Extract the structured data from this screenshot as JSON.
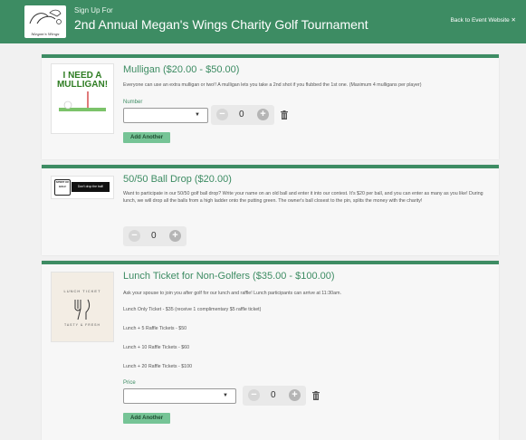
{
  "header": {
    "logo_text": "Megan's Wings",
    "subtitle": "Sign Up For",
    "title": "2nd Annual Megan's Wings Charity Golf Tournament",
    "back_link": "Back to Event Website ✕"
  },
  "items": [
    {
      "thumb_text": [
        "I NEED A",
        "MULLIGAN!"
      ],
      "title": "Mulligan ($20.00 - $50.00)",
      "description": "Everyone can use an extra mulligan or two!!  A mulligan lets you take a 2nd shot if you flubbed the 1st one. (Maximum 4 mulligans per player)",
      "field_label": "Number",
      "select_value": "",
      "quantity": "0",
      "add_label": "Add Another"
    },
    {
      "thumb_text": [
        "SPIRIT OF",
        "GOLF",
        "Don't drop the ball!"
      ],
      "title": "50/50 Ball Drop ($20.00)",
      "description": "Want to participate in our 50/50 golf ball drop? Write your name on an old ball and enter it into our contest. It's $20 per ball, and you can enter as many as you like! During lunch, we will drop all the balls from a high ladder onto the putting green. The owner's ball closest to the pin, splits the money with the charity!",
      "quantity": "0"
    },
    {
      "thumb_text": [
        "LUNCH TICKET",
        "TASTY & FRESH"
      ],
      "title": "Lunch Ticket for Non-Golfers ($35.00 - $100.00)",
      "description": "Ask your spouse to join you after golf for our lunch and raffle!  Lunch participants can arrive at 11:30am.",
      "options": [
        "Lunch Only Ticket - $35 (receive 1 complimentary $5 raffle ticket)",
        "Lunch + 5 Raffle Tickets - $50",
        "Lunch + 10 Raffle Tickets - $60",
        "Lunch + 20 Raffle Tickets - $100"
      ],
      "field_label": "Price",
      "select_value": "",
      "quantity": "0",
      "add_label": "Add Another"
    }
  ],
  "icons": {
    "minus": "−",
    "plus": "+",
    "caret": "▼"
  },
  "colors": {
    "brand_green": "#3d8c63",
    "button_green": "#76c496"
  }
}
